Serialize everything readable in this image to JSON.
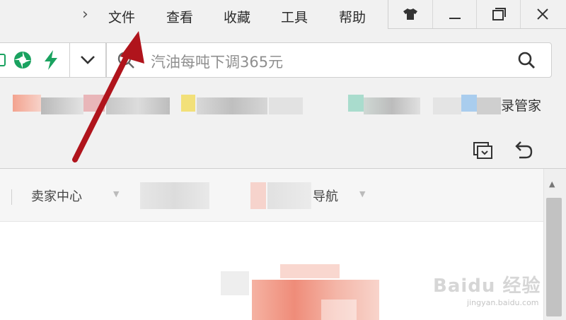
{
  "menu": {
    "items": [
      {
        "id": "file",
        "label": "文件"
      },
      {
        "id": "view",
        "label": "查看"
      },
      {
        "id": "favorites",
        "label": "收藏"
      },
      {
        "id": "tools",
        "label": "工具"
      },
      {
        "id": "help",
        "label": "帮助"
      }
    ]
  },
  "window_controls": [
    "shirt-icon",
    "minimize-icon",
    "restore-icon",
    "close-icon"
  ],
  "address_bar": {
    "search_placeholder": "汽油每吨下调365元",
    "icons": [
      "shield-icon",
      "speed-icon",
      "chevron-down-icon",
      "search-icon"
    ]
  },
  "bookmarks": {
    "visible_tail": "录管家"
  },
  "toolbar": {
    "icons": [
      "tabs-icon",
      "undo-icon"
    ]
  },
  "page": {
    "nav": {
      "seller_center": "卖家中心",
      "nav_tail": "导航"
    },
    "watermark": {
      "brand": "Baidu 经验",
      "url": "jingyan.baidu.com"
    }
  },
  "colors": {
    "accent_green": "#1aa260",
    "arrow_red": "#b0141c"
  }
}
